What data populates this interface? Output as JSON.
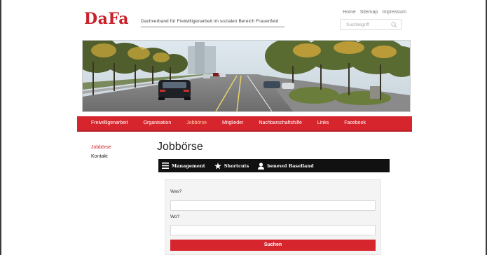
{
  "header": {
    "logo_text": "DaFa",
    "tagline": "Dachverband für Freiwilligenarbeit im sozialen Bereich Frauenfeld",
    "top_links": [
      "Home",
      "Sitemap",
      "Impressum"
    ],
    "search_placeholder": "Suchbegriff"
  },
  "nav": {
    "items": [
      "Freiwilligenarbeit",
      "Organisation",
      "Jobbörse",
      "Mitglieder",
      "Nachbarschaftshilfe",
      "Links",
      "Facebook"
    ],
    "active": "Jobbörse",
    "colors": {
      "bar": "#d7252d",
      "active_text": "#ffd3a8"
    }
  },
  "sidebar": {
    "items": [
      "Jobbörse",
      "Kontakt"
    ],
    "active": "Jobbörse"
  },
  "main": {
    "title": "Jobbörse",
    "toolbar": {
      "items": [
        {
          "label": "Management",
          "icon": "menu-icon"
        },
        {
          "label": "Shortcuts",
          "icon": "star-icon"
        },
        {
          "label": "benevol Baselland",
          "icon": "user-icon"
        }
      ]
    },
    "form": {
      "was_label": "Was?",
      "was_value": "",
      "wo_label": "Wo?",
      "wo_value": "",
      "submit_label": "Suchen"
    }
  },
  "colors": {
    "brand_red": "#c9202a",
    "toolbar_bg": "#111111"
  }
}
